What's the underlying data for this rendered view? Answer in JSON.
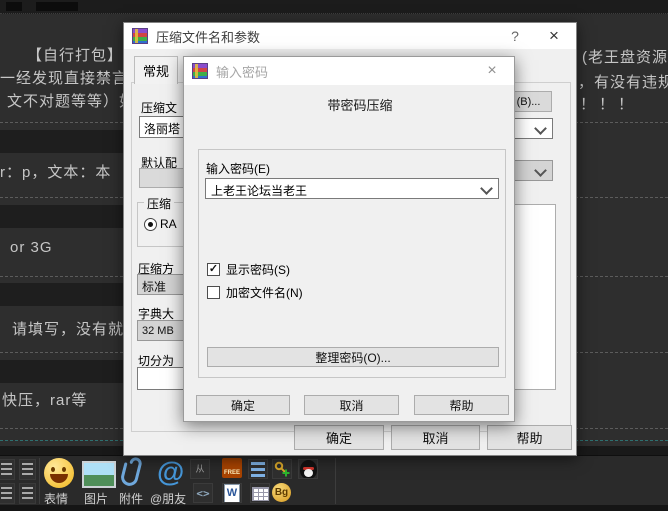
{
  "background": {
    "post_lines": [
      "【自行打包】是",
      "一经发现直接禁言",
      "文不对题等等）如",
      "r：p，文本：本",
      "or 3G",
      "请填写，没有就填",
      "快压，rar等"
    ],
    "right_lines": [
      "(老王盘资源",
      "，有没有违规",
      "！！！"
    ],
    "toolbar": {
      "items": [
        {
          "label": "表情",
          "icon": "emoji-icon"
        },
        {
          "label": "图片",
          "icon": "picture-icon"
        },
        {
          "label": "附件",
          "icon": "paperclip-icon"
        },
        {
          "label": "@朋友",
          "icon": "at-icon"
        }
      ],
      "at_glyph": "@",
      "free_label": "FREE",
      "code_glyph": "<>",
      "hidden_glyph": "从",
      "word_glyph": "W",
      "coin_label": "Bg"
    }
  },
  "main_dialog": {
    "title": "压缩文件名和参数",
    "help_glyph": "?",
    "close_glyph": "×",
    "tab_general": "常规",
    "fields": {
      "archive_label": "压缩文",
      "archive_value": "洛丽塔",
      "profile_label": "默认配",
      "format_caption": "压缩",
      "format_radio_label": "RA",
      "method_label": "压缩方",
      "method_value": "标准",
      "dict_label": "字典大",
      "dict_value": "32 MB",
      "split_label": "切分为",
      "browse_fragment": "(B)..."
    },
    "buttons": [
      "确定",
      "取消",
      "帮助"
    ]
  },
  "password_dialog": {
    "title": "输入密码",
    "close_glyph": "×",
    "heading": "带密码压缩",
    "input_label": "输入密码(E)",
    "input_value": "上老王论坛当老王",
    "checkboxes": [
      {
        "label": "显示密码(S)",
        "checked": true,
        "mark": "✓"
      },
      {
        "label": "加密文件名(N)",
        "checked": false,
        "mark": ""
      }
    ],
    "organize_button": "整理密码(O)...",
    "buttons": [
      "确定",
      "取消",
      "帮助"
    ]
  },
  "colors": {
    "page_bg": "#2e2e2e",
    "dialog_bg": "#f0f0f0",
    "titlebar_bg": "#ffffff",
    "button_bg": "#e3e3e3",
    "accent_blue": "#4596d8",
    "free_orange": "#a84300",
    "coin_gold": "#d79a20"
  }
}
